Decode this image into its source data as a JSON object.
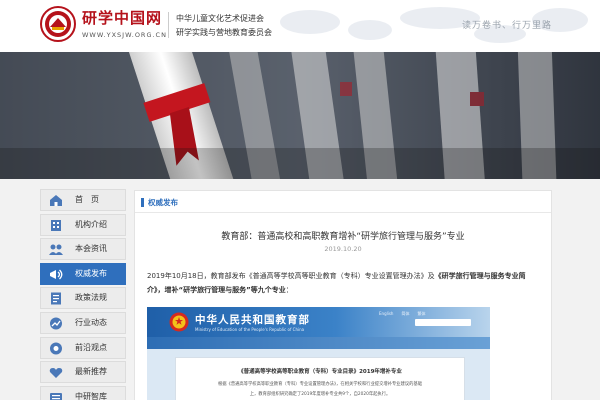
{
  "header": {
    "site_title": "研学中国网",
    "site_url": "WWW.YXSJW.ORG.CN",
    "org_line1": "中华儿童文化艺术促进会",
    "org_line2": "研学实践与营地教育委员会",
    "slogan": "读万卷书、行万里路"
  },
  "sidebar": {
    "items": [
      {
        "label": "首　页",
        "icon": "home-icon",
        "active": false
      },
      {
        "label": "机构介绍",
        "icon": "building-icon",
        "active": false
      },
      {
        "label": "本会资讯",
        "icon": "news-icon",
        "active": false
      },
      {
        "label": "权威发布",
        "icon": "announcement-icon",
        "active": true
      },
      {
        "label": "政策法规",
        "icon": "document-icon",
        "active": false
      },
      {
        "label": "行业动态",
        "icon": "trend-icon",
        "active": false
      },
      {
        "label": "前沿观点",
        "icon": "viewpoint-icon",
        "active": false
      },
      {
        "label": "最新推荐",
        "icon": "recommend-icon",
        "active": false
      },
      {
        "label": "中研智库",
        "icon": "think-tank-icon",
        "active": false
      }
    ]
  },
  "content": {
    "section_title": "权威发布",
    "article_title": "教育部：普通高校和高职教育增补“研学旅行管理与服务”专业",
    "article_date": "2019.10.20",
    "body_prefix": "2019年10月18日，教育部发布《普通高等学校高等职业教育（专科）专业设置管理办法》及",
    "body_bold": "《研学旅行管理与服务专业简介》，增补“研学旅行管理与服务”等九个专业",
    "body_suffix": "：",
    "embed": {
      "ministry_cn": "中华人民共和国教育部",
      "ministry_en": "Ministry of Education of the People's Republic of China",
      "top_links": "English　　简体　　繁体",
      "doc_title": "《普通高等学校高等职业教育（专科）专业目录》2019年增补专业",
      "doc_line1": "根据《普通高等学校高等职业教育（专科）专业设置管理办法》，在相关学校和行业提交增补专业建议的基础",
      "doc_line2": "上，教育部组织研究确定了2019年度增补专业共9个，自2020年起执行。"
    }
  },
  "colors": {
    "brand_red": "#b5121b",
    "accent_blue": "#2f6fbd"
  }
}
